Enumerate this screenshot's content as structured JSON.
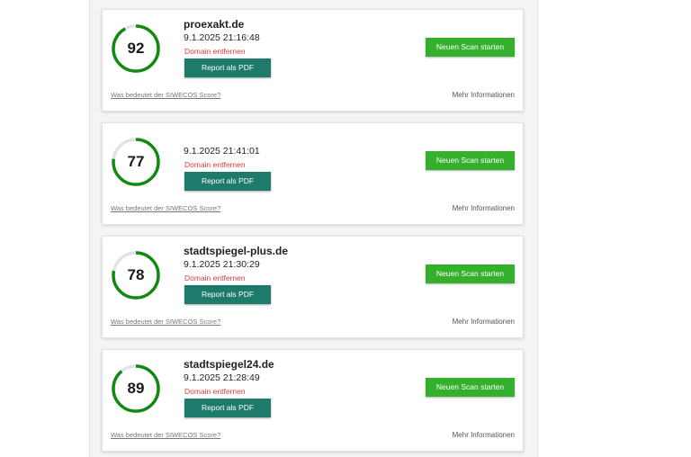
{
  "labels": {
    "remove_domain": "Domain entfernen",
    "report_pdf": "Report als PDF",
    "new_scan": "Neuen Scan starten",
    "score_info": "Was bedeutet der SIWECOS Score?",
    "more_info": "Mehr Informationen"
  },
  "colors": {
    "gauge_green": "#118a11",
    "gauge_track": "#e3e3e3",
    "pdf_button": "#1e7a6b",
    "scan_button": "#35b02c",
    "remove_link": "#e03a3a"
  },
  "scans": [
    {
      "domain": "proexakt.de",
      "date": "9.1.2025 21:16:48",
      "score": 92
    },
    {
      "domain": "",
      "date": "9.1.2025 21:41:01",
      "score": 77
    },
    {
      "domain": "stadtspiegel-plus.de",
      "date": "9.1.2025 21:30:29",
      "score": 78
    },
    {
      "domain": "stadtspiegel24.de",
      "date": "9.1.2025 21:28:49",
      "score": 89
    }
  ]
}
